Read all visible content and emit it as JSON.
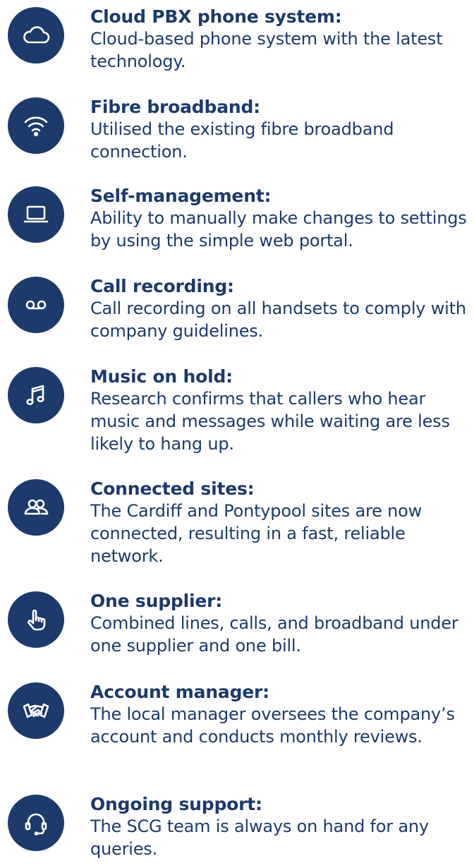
{
  "brand_color": "#1c3a6b",
  "features": [
    {
      "icon": "cloud-icon",
      "title": "Cloud PBX phone system:",
      "desc": "Cloud-based phone system with the latest technology."
    },
    {
      "icon": "wifi-icon",
      "title": "Fibre broadband:",
      "desc": "Utilised the existing fibre broadband connection."
    },
    {
      "icon": "laptop-icon",
      "title": "Self-management:",
      "desc": "Ability to manually make changes to settings by using the simple web portal."
    },
    {
      "icon": "voicemail-icon",
      "title": "Call recording:",
      "desc": "Call recording on all handsets to comply with company guidelines."
    },
    {
      "icon": "music-note-icon",
      "title": "Music on hold:",
      "desc": "Research confirms that callers who hear music and messages while waiting are less likely to hang up."
    },
    {
      "icon": "users-icon",
      "title": "Connected sites:",
      "desc": "The Cardiff and Pontypool sites are now connected, resulting in a fast, reliable network."
    },
    {
      "icon": "pointing-hand-icon",
      "title": "One supplier:",
      "desc": "Combined lines, calls, and broadband under one supplier and one bill."
    },
    {
      "icon": "handshake-icon",
      "title": "Account manager:",
      "desc": "The local manager oversees the company’s account and conducts monthly reviews."
    },
    {
      "icon": "headset-icon",
      "title": "Ongoing support:",
      "desc": "The SCG team is always on hand for any queries."
    }
  ]
}
